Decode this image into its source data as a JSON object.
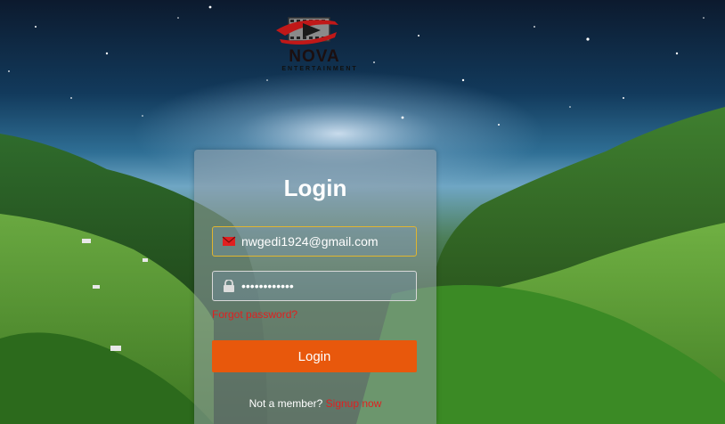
{
  "logo": {
    "name": "NOVA",
    "subtitle": "ENTERTAINMENT"
  },
  "login_card": {
    "title": "Login",
    "email": {
      "icon": "envelope-icon",
      "value": "nwgedi1924@gmail.com"
    },
    "password": {
      "icon": "lock-icon",
      "value": "••••••••••••"
    },
    "forgot_password": "Forgot password?",
    "login_button": "Login",
    "signup_prompt": "Not a member?",
    "signup_link": "Signup now"
  },
  "colors": {
    "accent": "#e8580c",
    "link": "#e02020",
    "focused_border": "#e0b530"
  }
}
